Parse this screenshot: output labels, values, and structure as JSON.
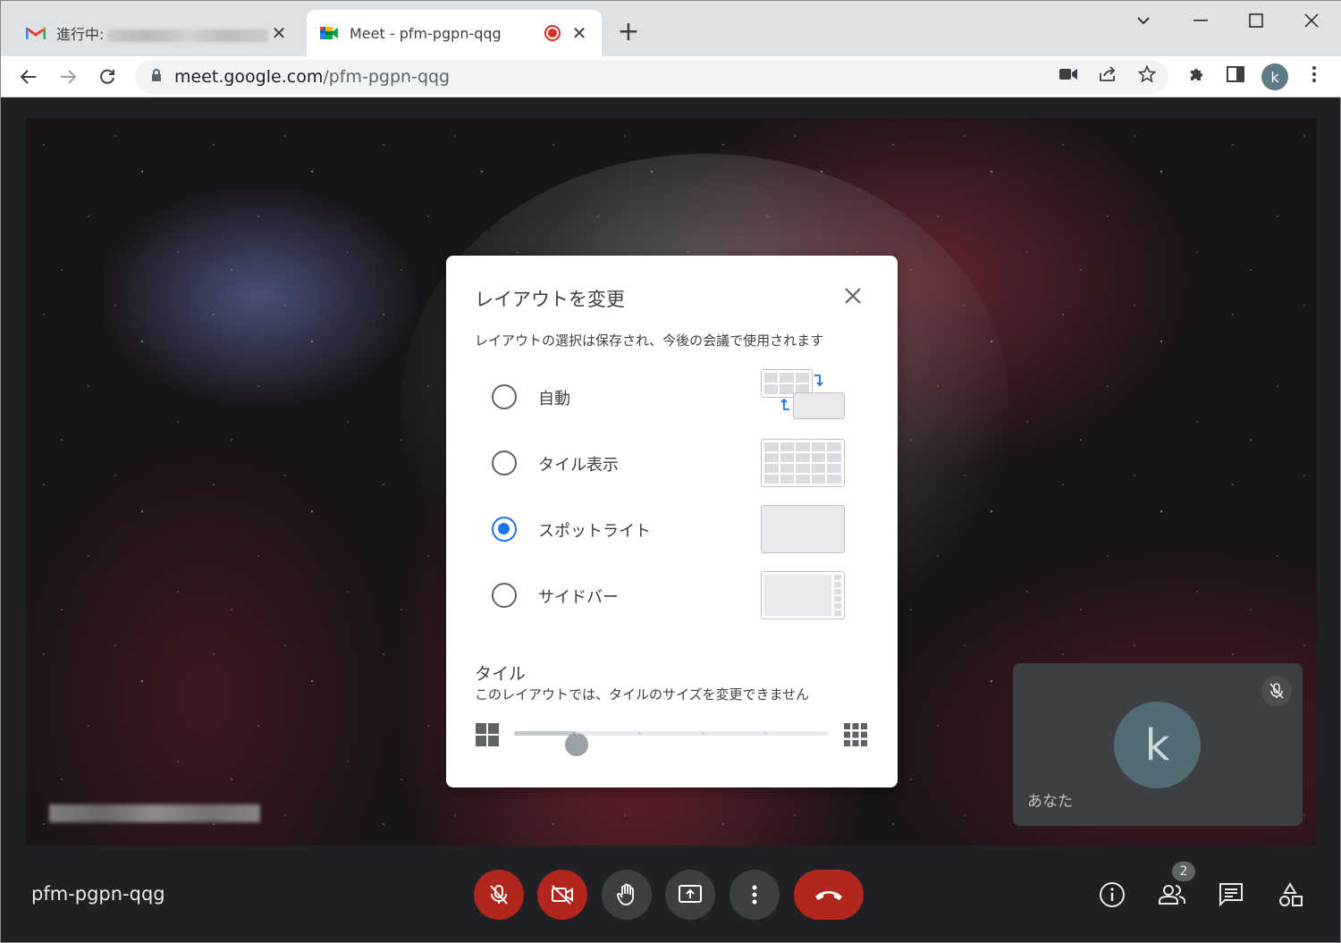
{
  "browser": {
    "tabs": [
      {
        "title": "進行中:",
        "icon": "gmail-icon",
        "active": false
      },
      {
        "title": "Meet - pfm-pgpn-qqg",
        "icon": "meet-icon",
        "active": true,
        "recording": true
      }
    ],
    "url_host": "meet.google.com",
    "url_path": "/pfm-pgpn-qqg",
    "profile_initial": "k"
  },
  "stage": {
    "self_tile": {
      "initial": "k",
      "label": "あなた"
    }
  },
  "dialog": {
    "title": "レイアウトを変更",
    "subtitle": "レイアウトの選択は保存され、今後の会議で使用されます",
    "options": [
      {
        "label": "自動",
        "selected": false,
        "thumb": "auto"
      },
      {
        "label": "タイル表示",
        "selected": false,
        "thumb": "tiled"
      },
      {
        "label": "スポットライト",
        "selected": true,
        "thumb": "spotlight"
      },
      {
        "label": "サイドバー",
        "selected": false,
        "thumb": "sidebar"
      }
    ],
    "tiles_title": "タイル",
    "tiles_subtitle": "このレイアウトでは、タイルのサイズを変更できません",
    "slider": {
      "value_fraction": 0.2,
      "steps": 6
    }
  },
  "bottom_bar": {
    "meeting_code": "pfm-pgpn-qqg",
    "participants_count": "2"
  },
  "colors": {
    "accent": "#1a73e8",
    "danger": "#b3261e",
    "surface": "#202124"
  }
}
